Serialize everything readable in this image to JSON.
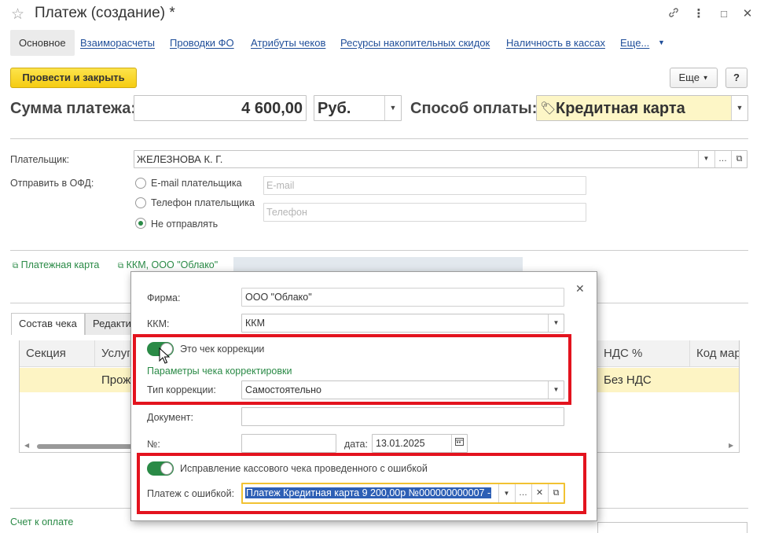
{
  "window": {
    "title": "Платеж (создание) *"
  },
  "tabs": [
    {
      "label": "Основное"
    },
    {
      "label": "Взаиморасчеты"
    },
    {
      "label": "Проводки ФО"
    },
    {
      "label": "Атрибуты чеков"
    },
    {
      "label": "Ресурсы накопительных скидок"
    },
    {
      "label": "Наличность в кассах"
    },
    {
      "label": "Еще..."
    }
  ],
  "toolbar": {
    "post_close": "Провести и закрыть",
    "more": "Еще",
    "help": "?"
  },
  "sum": {
    "label": "Сумма платежа:",
    "value": "4 600,00",
    "currency": "Руб.",
    "method_label": "Способ оплаты:",
    "method_value": "Кредитная карта"
  },
  "payer": {
    "label": "Плательщик:",
    "value": "ЖЕЛЕЗНОВА К. Г."
  },
  "ofd": {
    "label": "Отправить в ОФД:",
    "options": [
      "E-mail плательщика",
      "Телефон плательщика",
      "Не отправлять"
    ],
    "email_placeholder": "E-mail",
    "phone_placeholder": "Телефон"
  },
  "links": {
    "card": "Платежная карта",
    "kkm": "ККМ, ООО \"Облако\"",
    "bill": "Счет к оплате"
  },
  "receipt_tabs": [
    "Состав чека",
    "Редакти"
  ],
  "table": {
    "headers": [
      "Секция",
      "Услуг",
      "НДС %",
      "Код мар"
    ],
    "row": {
      "service": "Прож",
      "vat": "Без НДС"
    }
  },
  "popup": {
    "firm_label": "Фирма:",
    "firm_value": "ООО \"Облако\"",
    "kkm_label": "ККМ:",
    "kkm_value": "ККМ",
    "correction_toggle": "Это чек коррекции",
    "params_header": "Параметры чека корректировки",
    "type_label": "Тип коррекции:",
    "type_value": "Самостоятельно",
    "doc_label": "Документ:",
    "num_label": "№:",
    "date_label": "дата:",
    "date_value": "13.01.2025",
    "fix_toggle": "Исправление кассового чека проведенного с ошибкой",
    "err_label": "Платеж с ошибкой:",
    "err_value": "Платеж Кредитная карта 9 200,00р №000000000007 -"
  }
}
